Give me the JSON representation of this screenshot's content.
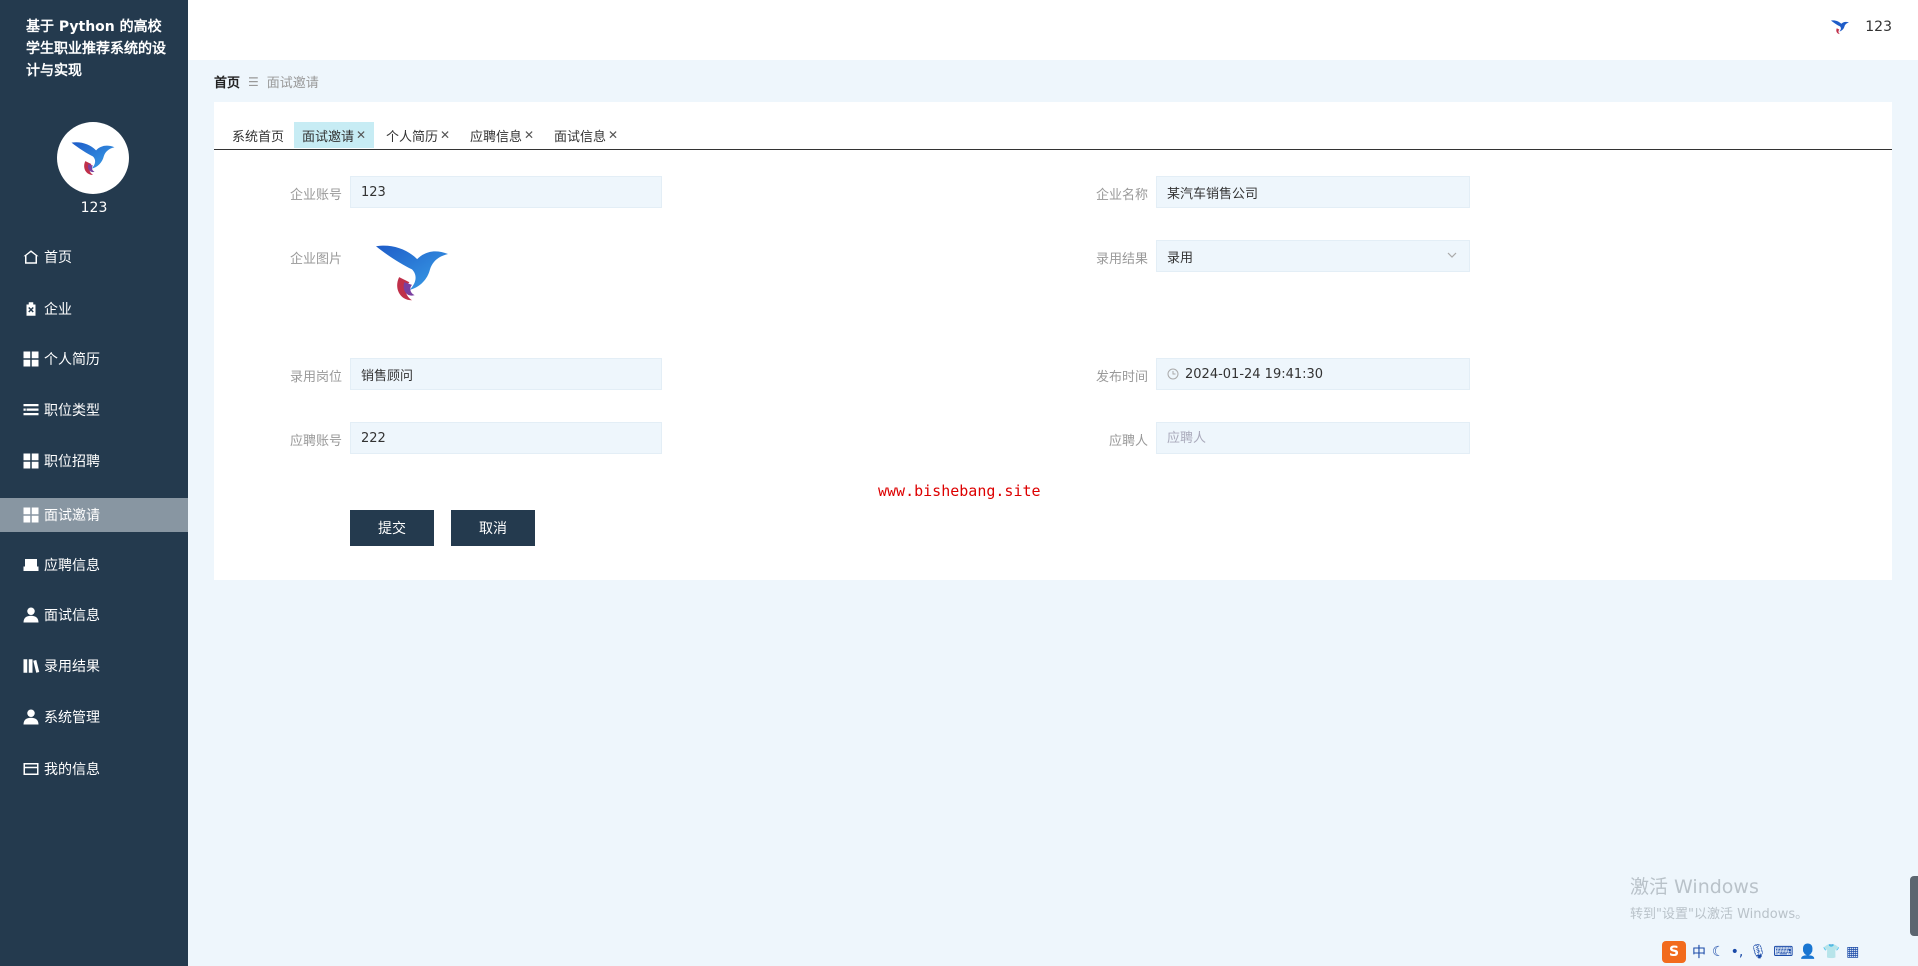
{
  "app": {
    "title": "基于 Python 的高校学生职业推荐系统的设计与实现"
  },
  "sidebar": {
    "username": "123",
    "items": [
      {
        "label": "首页",
        "icon": "home-icon"
      },
      {
        "label": "企业",
        "icon": "clipboard-x-icon"
      },
      {
        "label": "个人简历",
        "icon": "grid-icon"
      },
      {
        "label": "职位类型",
        "icon": "list-icon"
      },
      {
        "label": "职位招聘",
        "icon": "grid-icon"
      },
      {
        "label": "面试邀请",
        "icon": "grid-icon",
        "active": true
      },
      {
        "label": "应聘信息",
        "icon": "inbox-icon"
      },
      {
        "label": "面试信息",
        "icon": "user-icon"
      },
      {
        "label": "录用结果",
        "icon": "books-icon"
      },
      {
        "label": "系统管理",
        "icon": "user-icon"
      },
      {
        "label": "我的信息",
        "icon": "card-icon"
      }
    ]
  },
  "header": {
    "username": "123"
  },
  "breadcrumb": {
    "home": "首页",
    "current": "面试邀请"
  },
  "tabs": [
    {
      "label": "系统首页",
      "closable": false
    },
    {
      "label": "面试邀请",
      "closable": true,
      "active": true
    },
    {
      "label": "个人简历",
      "closable": true
    },
    {
      "label": "应聘信息",
      "closable": true
    },
    {
      "label": "面试信息",
      "closable": true
    }
  ],
  "form": {
    "company_account": {
      "label": "企业账号",
      "value": "123"
    },
    "company_name": {
      "label": "企业名称",
      "value": "某汽车销售公司"
    },
    "company_image": {
      "label": "企业图片"
    },
    "hire_result": {
      "label": "录用结果",
      "value": "录用"
    },
    "hire_position": {
      "label": "录用岗位",
      "value": "销售顾问"
    },
    "publish_time": {
      "label": "发布时间",
      "value": "2024-01-24 19:41:30"
    },
    "applicant_account": {
      "label": "应聘账号",
      "value": "222"
    },
    "applicant": {
      "label": "应聘人",
      "placeholder": "应聘人"
    },
    "submit_label": "提交",
    "cancel_label": "取消"
  },
  "watermark": "www.bishebang.site",
  "windows_notice": {
    "line1": "激活 Windows",
    "line2": "转到\"设置\"以激活 Windows。"
  },
  "tray": {
    "ime": "中",
    "sogou": "S"
  },
  "colors": {
    "sidebar": "#243a4e",
    "active_nav": "#8896a2",
    "active_tab": "#c7ecf4",
    "button": "#243a4e",
    "watermark": "#dd0000"
  }
}
